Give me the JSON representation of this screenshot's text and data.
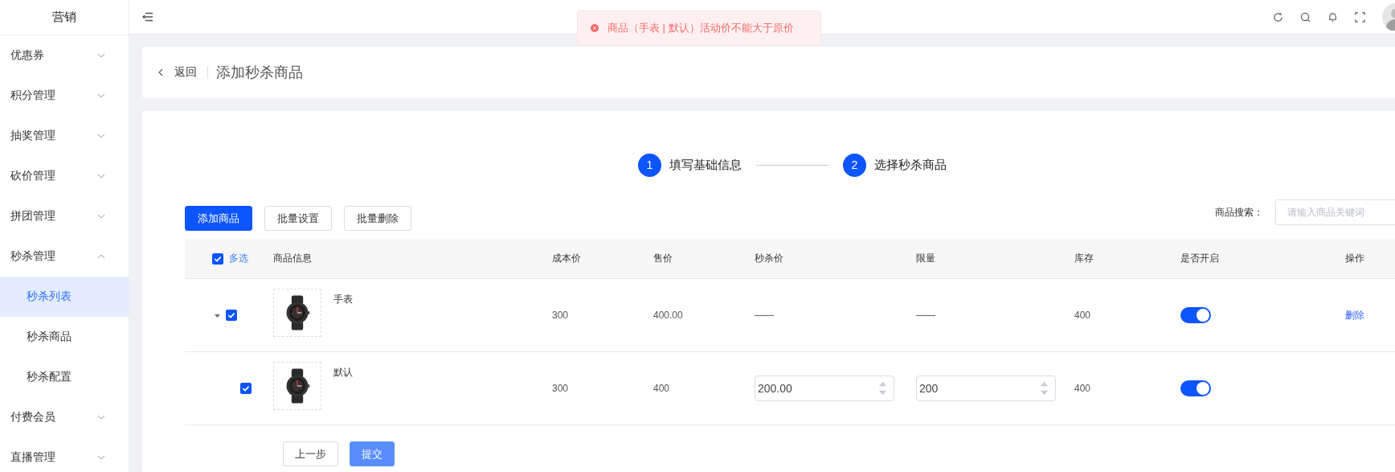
{
  "sidebar": {
    "title": "营销",
    "items": [
      {
        "label": "优惠券",
        "expanded": false
      },
      {
        "label": "积分管理",
        "expanded": false
      },
      {
        "label": "抽奖管理",
        "expanded": false
      },
      {
        "label": "砍价管理",
        "expanded": false
      },
      {
        "label": "拼团管理",
        "expanded": false
      },
      {
        "label": "秒杀管理",
        "expanded": true,
        "children": [
          {
            "label": "秒杀列表",
            "selected": true
          },
          {
            "label": "秒杀商品",
            "selected": false
          },
          {
            "label": "秒杀配置",
            "selected": false
          }
        ]
      },
      {
        "label": "付费会员",
        "expanded": false
      },
      {
        "label": "直播管理",
        "expanded": false
      }
    ]
  },
  "toast": {
    "message": "商品（手表 | 默认）活动价不能大于原价"
  },
  "page_header": {
    "back": "返回",
    "title": "添加秒杀商品"
  },
  "steps": [
    {
      "number": "1",
      "label": "填写基础信息"
    },
    {
      "number": "2",
      "label": "选择秒杀商品"
    }
  ],
  "toolbar": {
    "buttons": [
      {
        "label": "添加商品",
        "primary": true
      },
      {
        "label": "批量设置",
        "primary": false
      },
      {
        "label": "批量删除",
        "primary": false
      }
    ],
    "search_label": "商品搜索：",
    "search_placeholder": "请输入商品关键词"
  },
  "table": {
    "select_all": {
      "label": "多选",
      "checked": true
    },
    "columns": [
      "商品信息",
      "成本价",
      "售价",
      "秒杀价",
      "限量",
      "库存",
      "是否开启",
      "操作"
    ],
    "rows": [
      {
        "name": "手表",
        "checked": true,
        "expanded": true,
        "cost": "300",
        "price": "400.00",
        "seckill_price": "——",
        "limit": "——",
        "stock": "400",
        "enabled": true,
        "action": "删除",
        "children": [
          {
            "name": "默认",
            "checked": true,
            "cost": "300",
            "price": "400",
            "seckill_price_input": "200.00",
            "limit_input": "200",
            "stock": "400",
            "enabled": true
          }
        ]
      }
    ]
  },
  "footer": {
    "buttons": [
      {
        "label": "上一步",
        "primary": false
      },
      {
        "label": "提交",
        "primary": true
      }
    ]
  }
}
